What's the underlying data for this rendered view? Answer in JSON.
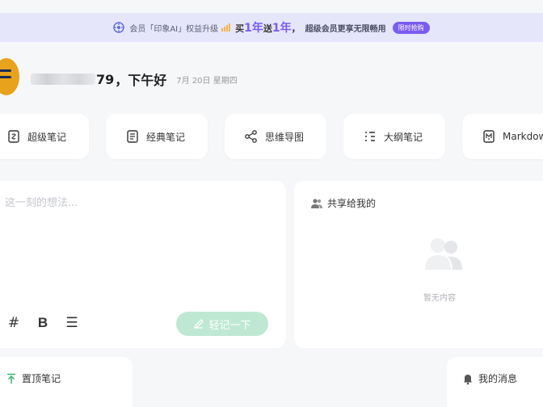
{
  "banner": {
    "prefix": "会员「印象AI」权益升级",
    "promo_buy": "买",
    "promo_1": "1年",
    "promo_gift": "送",
    "promo_2": "1年",
    "rest": "超级会员更享无限畅用",
    "badge": "限时抢购",
    "bar_color": "#f3b24b",
    "accent": "#7b5cf2"
  },
  "greeting": {
    "name_suffix": "79",
    "text": "，下午好",
    "date": "7月 20日 星期四"
  },
  "cards": [
    {
      "label": "超级笔记",
      "icon": "super-note-icon"
    },
    {
      "label": "经典笔记",
      "icon": "classic-note-icon"
    },
    {
      "label": "思维导图",
      "icon": "mind-map-icon"
    },
    {
      "label": "大纲笔记",
      "icon": "outline-note-icon"
    },
    {
      "label": "Markdown",
      "icon": "markdown-icon"
    }
  ],
  "note": {
    "placeholder": "这一刻的想法...",
    "submit": "轻记一下",
    "tools": [
      "#",
      "B",
      "☰"
    ],
    "submit_color": "#bfe8d2"
  },
  "shared": {
    "title": "共享给我的",
    "empty": "暂无内容"
  },
  "pinned": {
    "title": "置顶笔记",
    "icon_color": "#3cb371"
  },
  "messages": {
    "title": "我的消息"
  }
}
